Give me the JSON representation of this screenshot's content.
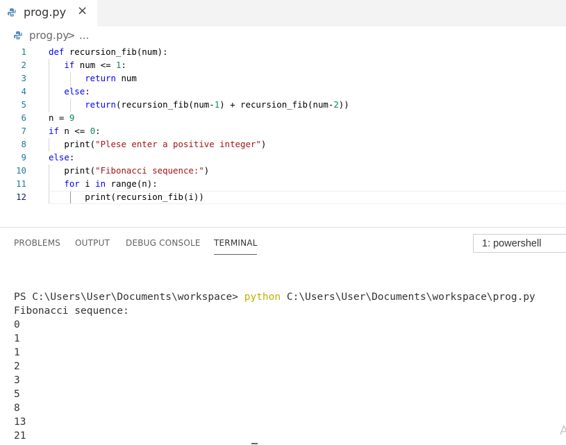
{
  "tab": {
    "label": "prog.py",
    "close": "×"
  },
  "breadcrumb": {
    "file": "prog.py",
    "separator": ">",
    "more": "..."
  },
  "editor": {
    "line_numbers": [
      "1",
      "2",
      "3",
      "4",
      "5",
      "6",
      "7",
      "8",
      "9",
      "10",
      "11",
      "12"
    ],
    "active_line": "12"
  },
  "panel": {
    "tabs": [
      "PROBLEMS",
      "OUTPUT",
      "DEBUG CONSOLE",
      "TERMINAL"
    ],
    "active_tab": "TERMINAL",
    "terminal_select": "1: powershell"
  },
  "terminal": {
    "prompt": "PS C:\\Users\\User\\Documents\\workspace> ",
    "command": "python",
    "argument": " C:\\Users\\User\\Documents\\workspace\\prog.py",
    "output": [
      "Fibonacci sequence:",
      "0",
      "1",
      "1",
      "2",
      "3",
      "5",
      "8",
      "13",
      "21"
    ]
  },
  "corner_text": "A",
  "colors": {
    "keyword": "#0000ff",
    "number": "#09885a",
    "string": "#a31515",
    "line_number": "#237893",
    "command": "#c0b000"
  }
}
